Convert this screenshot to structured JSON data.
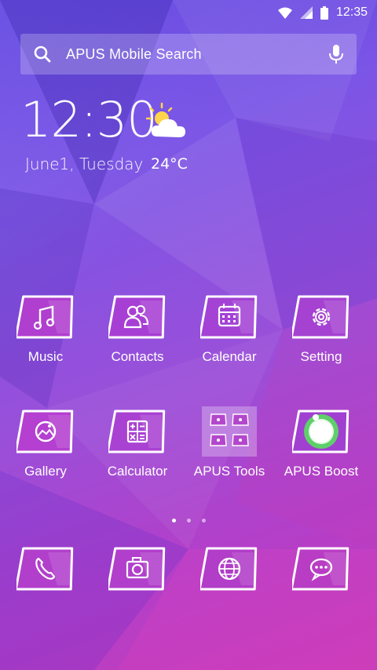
{
  "status_bar": {
    "time": "12:35"
  },
  "search": {
    "placeholder": "APUS Mobile Search"
  },
  "clock_widget": {
    "time": "12:30",
    "date": "June1, Tuesday",
    "temperature": "24°C",
    "weather_icon": "partly-cloudy-icon"
  },
  "apps_row1": [
    {
      "label": "Music",
      "icon": "music-note-icon"
    },
    {
      "label": "Contacts",
      "icon": "contacts-icon"
    },
    {
      "label": "Calendar",
      "icon": "calendar-icon"
    },
    {
      "label": "Setting",
      "icon": "gear-icon"
    }
  ],
  "apps_row2": [
    {
      "label": "Gallery",
      "icon": "gallery-icon"
    },
    {
      "label": "Calculator",
      "icon": "calculator-icon"
    },
    {
      "label": "APUS Tools",
      "icon": "folder-icon"
    },
    {
      "label": "APUS Boost",
      "icon": "boost-icon"
    }
  ],
  "dock": [
    {
      "icon": "phone-icon"
    },
    {
      "icon": "camera-icon"
    },
    {
      "icon": "browser-globe-icon"
    },
    {
      "icon": "message-bubble-icon"
    }
  ],
  "page_indicator": {
    "count": 3,
    "active": 1
  },
  "colors": {
    "accent": "#ffffff",
    "bg_top": "#5b3fe0",
    "bg_bottom": "#c63bb8",
    "boost_green": "#5fcf6a"
  }
}
